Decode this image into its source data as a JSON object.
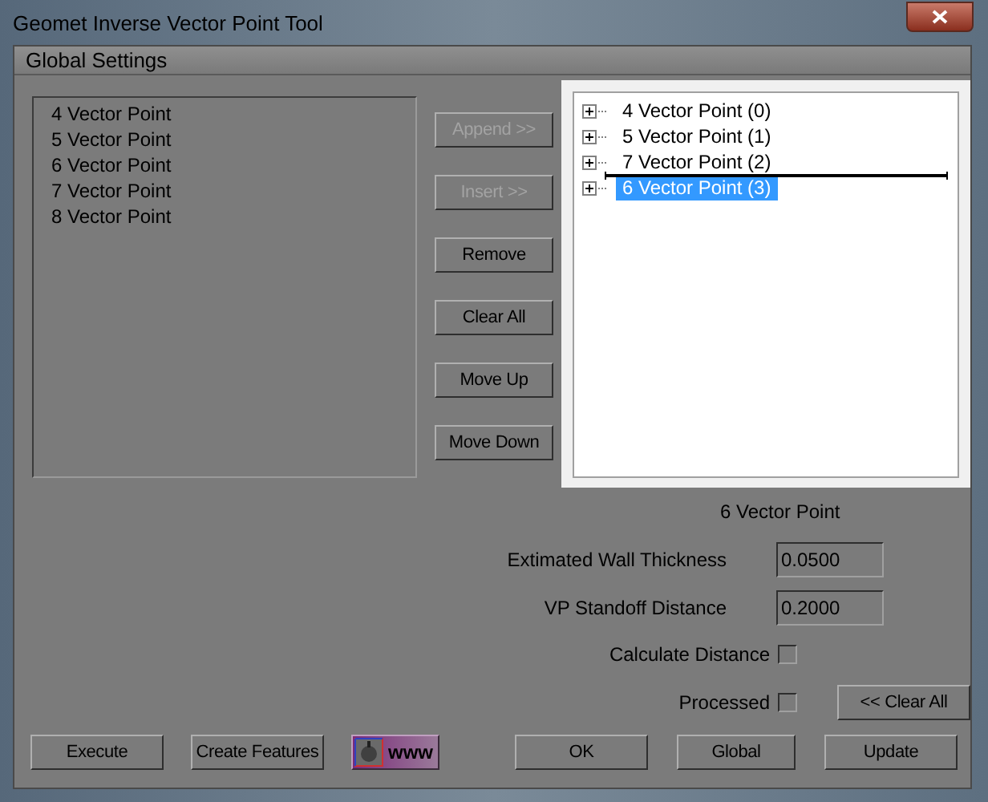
{
  "window": {
    "title": "Geomet Inverse Vector Point Tool"
  },
  "section": {
    "title": "Global Settings"
  },
  "source_list": {
    "items": [
      "4 Vector Point",
      "5 Vector Point",
      "6 Vector Point",
      "7 Vector Point",
      "8 Vector Point"
    ]
  },
  "list_buttons": [
    {
      "label": "Append >>",
      "disabled": true
    },
    {
      "label": "Insert >>",
      "disabled": true
    },
    {
      "label": "Remove",
      "disabled": false
    },
    {
      "label": "Clear All",
      "disabled": false
    },
    {
      "label": "Move Up",
      "disabled": false
    },
    {
      "label": "Move Down",
      "disabled": false
    }
  ],
  "tree": {
    "items": [
      {
        "label": "4 Vector Point (0)",
        "selected": false,
        "expanded": false
      },
      {
        "label": "5 Vector Point (1)",
        "selected": false,
        "expanded": false
      },
      {
        "label": "7 Vector Point (2)",
        "selected": false,
        "expanded": false
      },
      {
        "label": "6 Vector Point (3)",
        "selected": true,
        "expanded": false
      }
    ]
  },
  "current_item": "6 Vector Point",
  "fields": [
    {
      "label": "Extimated Wall Thickness",
      "value": "0.0500"
    },
    {
      "label": "VP Standoff Distance",
      "value": "0.2000"
    }
  ],
  "checkboxes": [
    {
      "label": "Calculate Distance",
      "checked": false
    },
    {
      "label": "Processed",
      "checked": false
    }
  ],
  "clear_button": "<< Clear All",
  "left_buttons": [
    {
      "kind": "text",
      "label": "Execute"
    },
    {
      "kind": "text",
      "label": "Create Features"
    },
    {
      "kind": "web",
      "label": "www"
    }
  ],
  "right_buttons": [
    {
      "kind": "text",
      "label": "OK"
    },
    {
      "kind": "text",
      "label": "Global"
    },
    {
      "kind": "text",
      "label": "Update"
    }
  ]
}
